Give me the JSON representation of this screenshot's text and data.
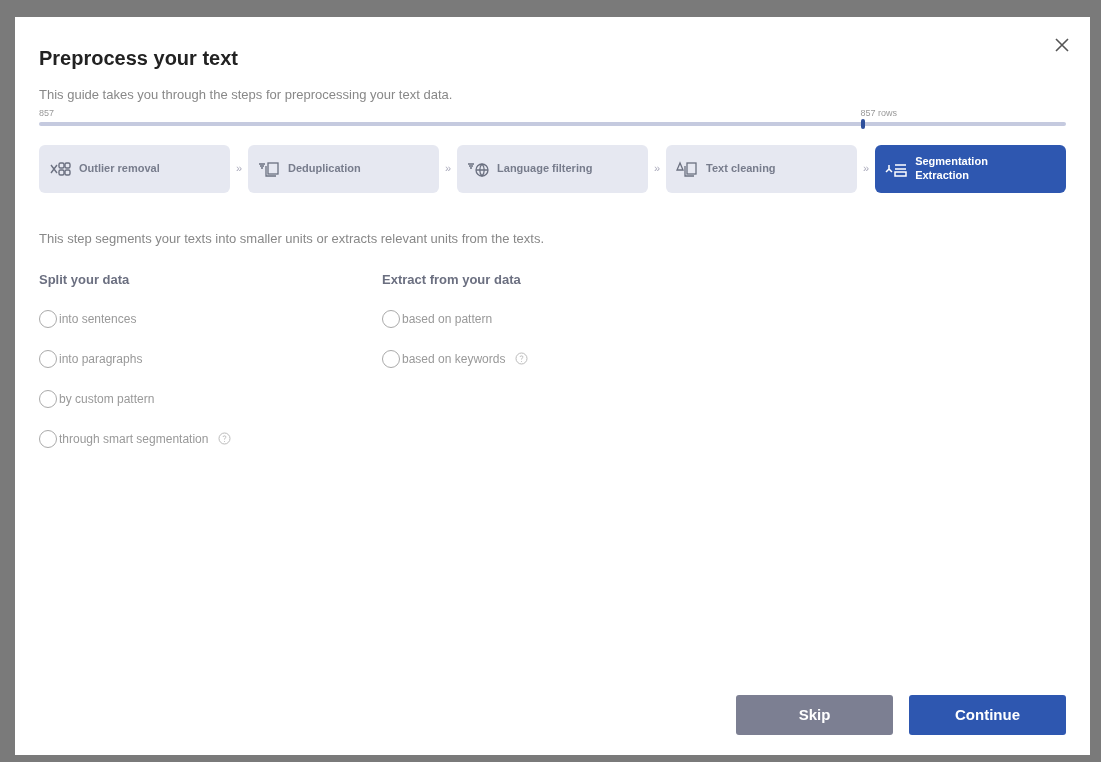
{
  "dialog": {
    "title": "Preprocess your text",
    "subtitle": "This guide takes you through the steps for preprocessing your text data."
  },
  "slider": {
    "min_label": "857",
    "value_label": "857 rows",
    "level": 0.8
  },
  "steps": [
    {
      "label": "Outlier removal",
      "selected": false
    },
    {
      "label": "Deduplication",
      "selected": false
    },
    {
      "label": "Language filtering",
      "selected": false
    },
    {
      "label": "Text cleaning",
      "selected": false
    },
    {
      "label": "Segmentation Extraction",
      "selected": true
    }
  ],
  "separator": "»",
  "description": "This step segments your texts into smaller units or extracts relevant units from the texts.",
  "groups": [
    {
      "heading": "Split your data",
      "options": [
        {
          "label": "into sentences",
          "selected": false,
          "help": false
        },
        {
          "label": "into paragraphs",
          "selected": false,
          "help": false
        },
        {
          "label": "by custom pattern",
          "selected": false,
          "help": false
        },
        {
          "label": "through smart segmentation",
          "selected": false,
          "help": true
        }
      ]
    },
    {
      "heading": "Extract from your data",
      "options": [
        {
          "label": "based on pattern",
          "selected": false,
          "help": false
        },
        {
          "label": "based on keywords",
          "selected": false,
          "help": true
        }
      ]
    }
  ],
  "buttons": [
    {
      "label": "Skip",
      "kind": "secondary"
    },
    {
      "label": "Continue",
      "kind": "primary"
    }
  ]
}
